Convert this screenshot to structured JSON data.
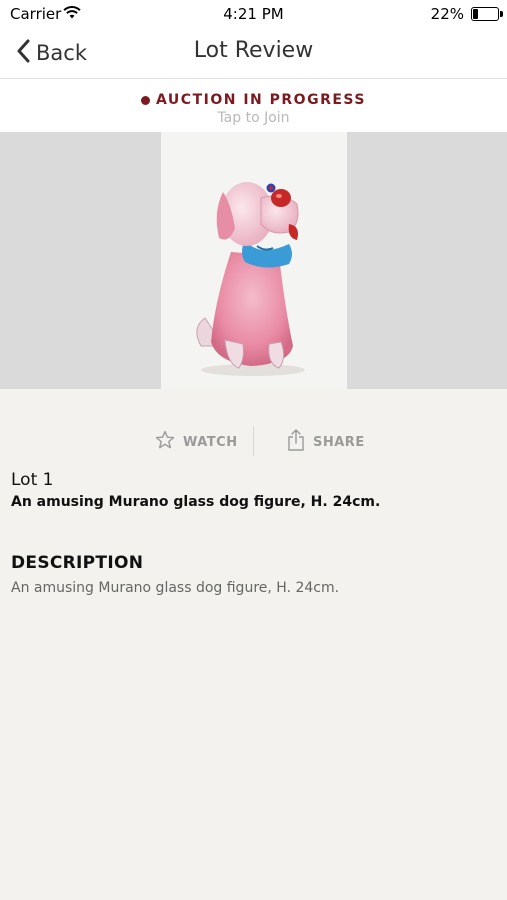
{
  "status_bar": {
    "carrier": "Carrier",
    "time": "4:21 PM",
    "battery": "22%",
    "battery_level": 0.22
  },
  "nav": {
    "back_label": "Back",
    "title": "Lot Review"
  },
  "auction_banner": {
    "status": "AUCTION IN PROGRESS",
    "action": "Tap to Join",
    "accent_color": "#7b1b1f"
  },
  "actions": {
    "watch_label": "WATCH",
    "share_label": "SHARE"
  },
  "lot": {
    "number": "Lot 1",
    "title": "An amusing Murano glass dog figure, H. 24cm.",
    "description_heading": "DESCRIPTION",
    "description": "An amusing Murano glass dog figure, H. 24cm."
  }
}
